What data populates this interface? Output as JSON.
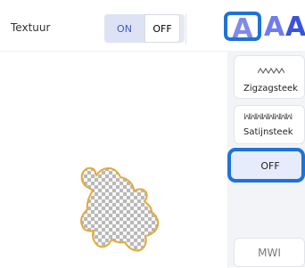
{
  "texture": {
    "label": "Textuur",
    "on_label": "ON",
    "off_label": "OFF"
  },
  "font_buttons": [
    {
      "label": "A",
      "selected": true
    },
    {
      "label": "A",
      "selected": false
    },
    {
      "label": "A",
      "selected": false
    }
  ],
  "stitch_cards": [
    {
      "label": "Zigzagsteek"
    },
    {
      "label": "Satijnsteek"
    }
  ],
  "off_option": {
    "label": "OFF"
  },
  "lower_card": {
    "label": "MWI"
  },
  "colors": {
    "accent_blue": "#1e73d8",
    "on_text": "#3b5cc9",
    "bear_outline": "#e2ab3b",
    "checker_dark": "#b8b8b8",
    "checker_light": "#f7f7f7"
  }
}
